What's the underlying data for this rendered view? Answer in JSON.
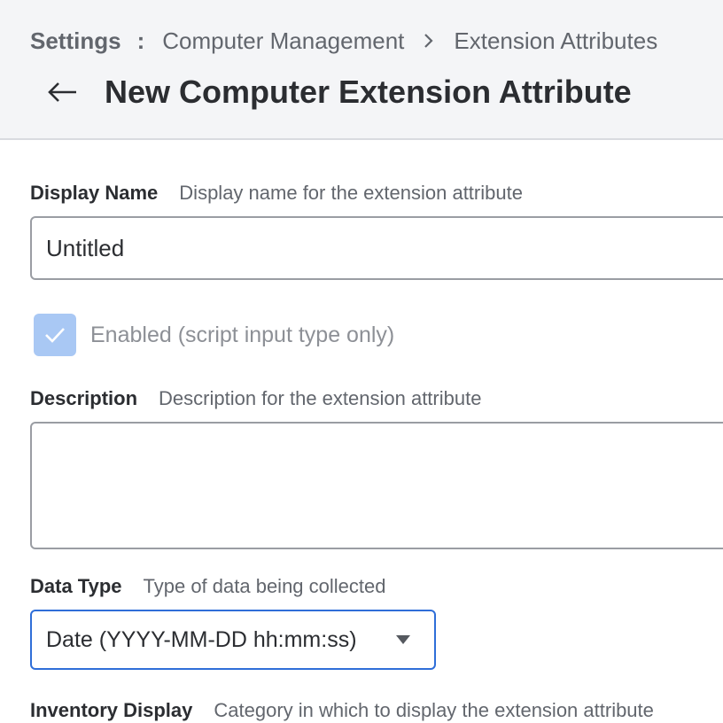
{
  "breadcrumb": {
    "root": "Settings",
    "separator": ":",
    "items": [
      "Computer Management",
      "Extension Attributes"
    ]
  },
  "header": {
    "title": "New Computer Extension Attribute"
  },
  "display_name": {
    "label": "Display Name",
    "hint": "Display name for the extension attribute",
    "value": "Untitled"
  },
  "enabled": {
    "label": "Enabled (script input type only)",
    "checked": true
  },
  "description": {
    "label": "Description",
    "hint": "Description for the extension attribute",
    "value": ""
  },
  "data_type": {
    "label": "Data Type",
    "hint": "Type of data being collected",
    "selected": "Date (YYYY-MM-DD hh:mm:ss)"
  },
  "inventory_display": {
    "label": "Inventory Display",
    "hint": "Category in which to display the extension attribute"
  },
  "icons": [
    "arrow-left-icon",
    "chevron-right-icon",
    "checkmark-icon",
    "caret-down-icon"
  ],
  "colors": {
    "header_bg": "#f4f5f7",
    "accent": "#2f6ed8",
    "checkbox_disabled": "#a9c8f4"
  }
}
